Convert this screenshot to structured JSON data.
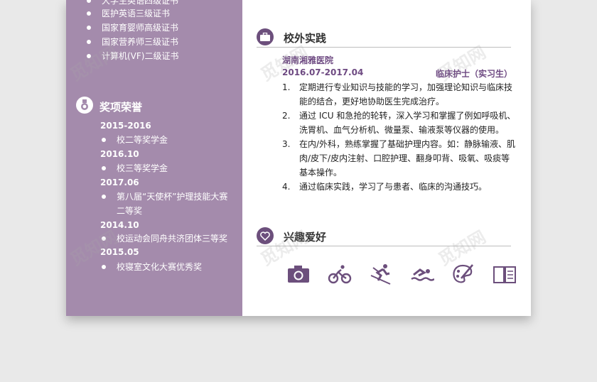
{
  "sidebar": {
    "certificates": [
      "大学生英语四级证书",
      "医护英语三级证书",
      "国家育婴师高级证书",
      "国家营养师三级证书",
      "计算机(VF)二级证书"
    ],
    "awards_title": "奖项荣誉",
    "awards": [
      {
        "year": "2015-2016",
        "items": [
          "校二等奖学金"
        ]
      },
      {
        "year": "2016.10",
        "items": [
          "校三等奖学金"
        ]
      },
      {
        "year": "2017.06",
        "items": [
          "第八届“天使杯”护理技能大赛",
          "二等奖"
        ]
      },
      {
        "year": "2014.10",
        "items": [
          "校运动会同舟共济团体三等奖"
        ]
      },
      {
        "year": "2015.05",
        "items": [
          "校寝室文化大赛优秀奖"
        ]
      }
    ]
  },
  "practice": {
    "title": "校外实践",
    "org": "湖南湘雅医院",
    "dates": "2016.07-2017.04",
    "role": "临床护士（实习生）",
    "duties": [
      {
        "num": "1.",
        "text": "定期进行专业知识与技能的学习，加强理论知识与临床技能的结合，更好地协助医生完成治疗。"
      },
      {
        "num": "2.",
        "text": "通过 ICU 和急抢的轮转，深入学习和掌握了例如呼吸机、洗胃机、血气分析机、微量泵、输液泵等仪器的使用。"
      },
      {
        "num": "3.",
        "text": "在内/外科，熟练掌握了基础护理内容。如：静脉输液、肌肉/皮下/皮内注射、口腔护理、翻身叩背、吸氧、吸痰等基本操作。"
      },
      {
        "num": "4.",
        "text": "通过临床实践，学习了与患者、临床的沟通技巧。"
      }
    ]
  },
  "hobbies": {
    "title": "兴趣爱好",
    "icons": [
      "camera-icon",
      "cycling-icon",
      "skiing-icon",
      "swimming-icon",
      "painting-icon",
      "reading-icon"
    ]
  },
  "watermark_text": "觅知网",
  "colors": {
    "sidebar": "#a48bac",
    "accent": "#6e4a82",
    "icon_dark": "#6c4f7c"
  }
}
